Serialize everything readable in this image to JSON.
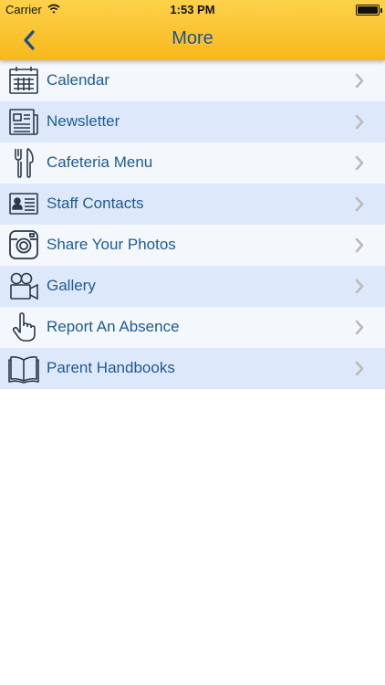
{
  "status_bar": {
    "carrier": "Carrier",
    "time": "1:53 PM"
  },
  "nav": {
    "title": "More",
    "back_icon": "chevron-left-icon"
  },
  "colors": {
    "header_top": "#fdd24a",
    "header_bottom": "#f6b81c",
    "title": "#1f4f8c",
    "row_text": "#1e5a94",
    "row_odd": "#f4f8fd",
    "row_even": "#dde9fa",
    "icon_stroke": "#2b3a4a",
    "chevron": "#b9b9b9"
  },
  "menu": {
    "items": [
      {
        "label": "Calendar",
        "icon": "calendar-icon"
      },
      {
        "label": "Newsletter",
        "icon": "newspaper-icon"
      },
      {
        "label": "Cafeteria Menu",
        "icon": "fork-knife-icon"
      },
      {
        "label": "Staff Contacts",
        "icon": "contact-card-icon"
      },
      {
        "label": "Share Your Photos",
        "icon": "camera-icon"
      },
      {
        "label": "Gallery",
        "icon": "video-camera-icon"
      },
      {
        "label": "Report An Absence",
        "icon": "hand-pointer-icon"
      },
      {
        "label": "Parent Handbooks",
        "icon": "open-book-icon"
      }
    ]
  }
}
